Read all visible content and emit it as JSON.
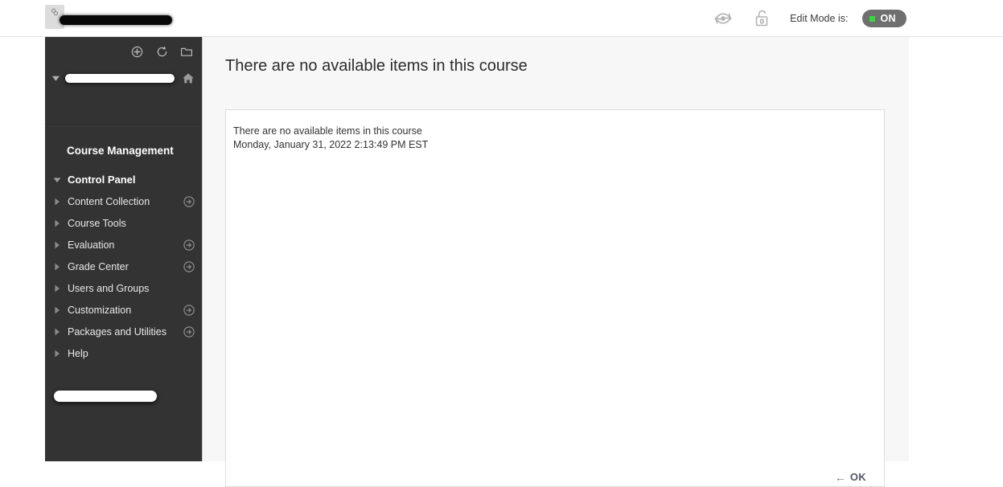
{
  "topbar": {
    "brand_icon": "broken-image-icon",
    "brand_redacted": "",
    "student_preview_icon": "eye-refresh-icon",
    "lock_icon": "open-padlock-icon",
    "edit_mode_label": "Edit Mode is:",
    "edit_mode_state": "ON",
    "edit_mode_on_color": "#36d63c",
    "edit_mode_pill_color": "#6f6f6f"
  },
  "sidebar": {
    "background_color": "#333333",
    "tools": [
      {
        "name": "add-content-icon",
        "glyph": "plus-in-circle"
      },
      {
        "name": "refresh-icon",
        "glyph": "circular-arrow"
      },
      {
        "name": "folder-view-icon",
        "glyph": "folder"
      }
    ],
    "course_title_redacted": "",
    "home_icon": "home-icon",
    "section_header": "Course Management",
    "items": [
      {
        "label": "Control Panel",
        "level": 0,
        "expanded": true,
        "has_go": false
      },
      {
        "label": "Content Collection",
        "level": 1,
        "expanded": false,
        "has_go": true
      },
      {
        "label": "Course Tools",
        "level": 1,
        "expanded": false,
        "has_go": false
      },
      {
        "label": "Evaluation",
        "level": 1,
        "expanded": false,
        "has_go": true
      },
      {
        "label": "Grade Center",
        "level": 1,
        "expanded": false,
        "has_go": true
      },
      {
        "label": "Users and Groups",
        "level": 1,
        "expanded": false,
        "has_go": false
      },
      {
        "label": "Customization",
        "level": 1,
        "expanded": false,
        "has_go": true
      },
      {
        "label": "Packages and Utilities",
        "level": 1,
        "expanded": false,
        "has_go": true
      },
      {
        "label": "Help",
        "level": 1,
        "expanded": false,
        "has_go": false
      }
    ],
    "bottom_redacted": ""
  },
  "main": {
    "page_title": "There are no available items in this course",
    "panel": {
      "message": "There are no available items in this course",
      "timestamp": "Monday, January 31, 2022 2:13:49 PM EST"
    },
    "footer": {
      "ok_arrow": "←",
      "ok_label": "OK"
    }
  }
}
